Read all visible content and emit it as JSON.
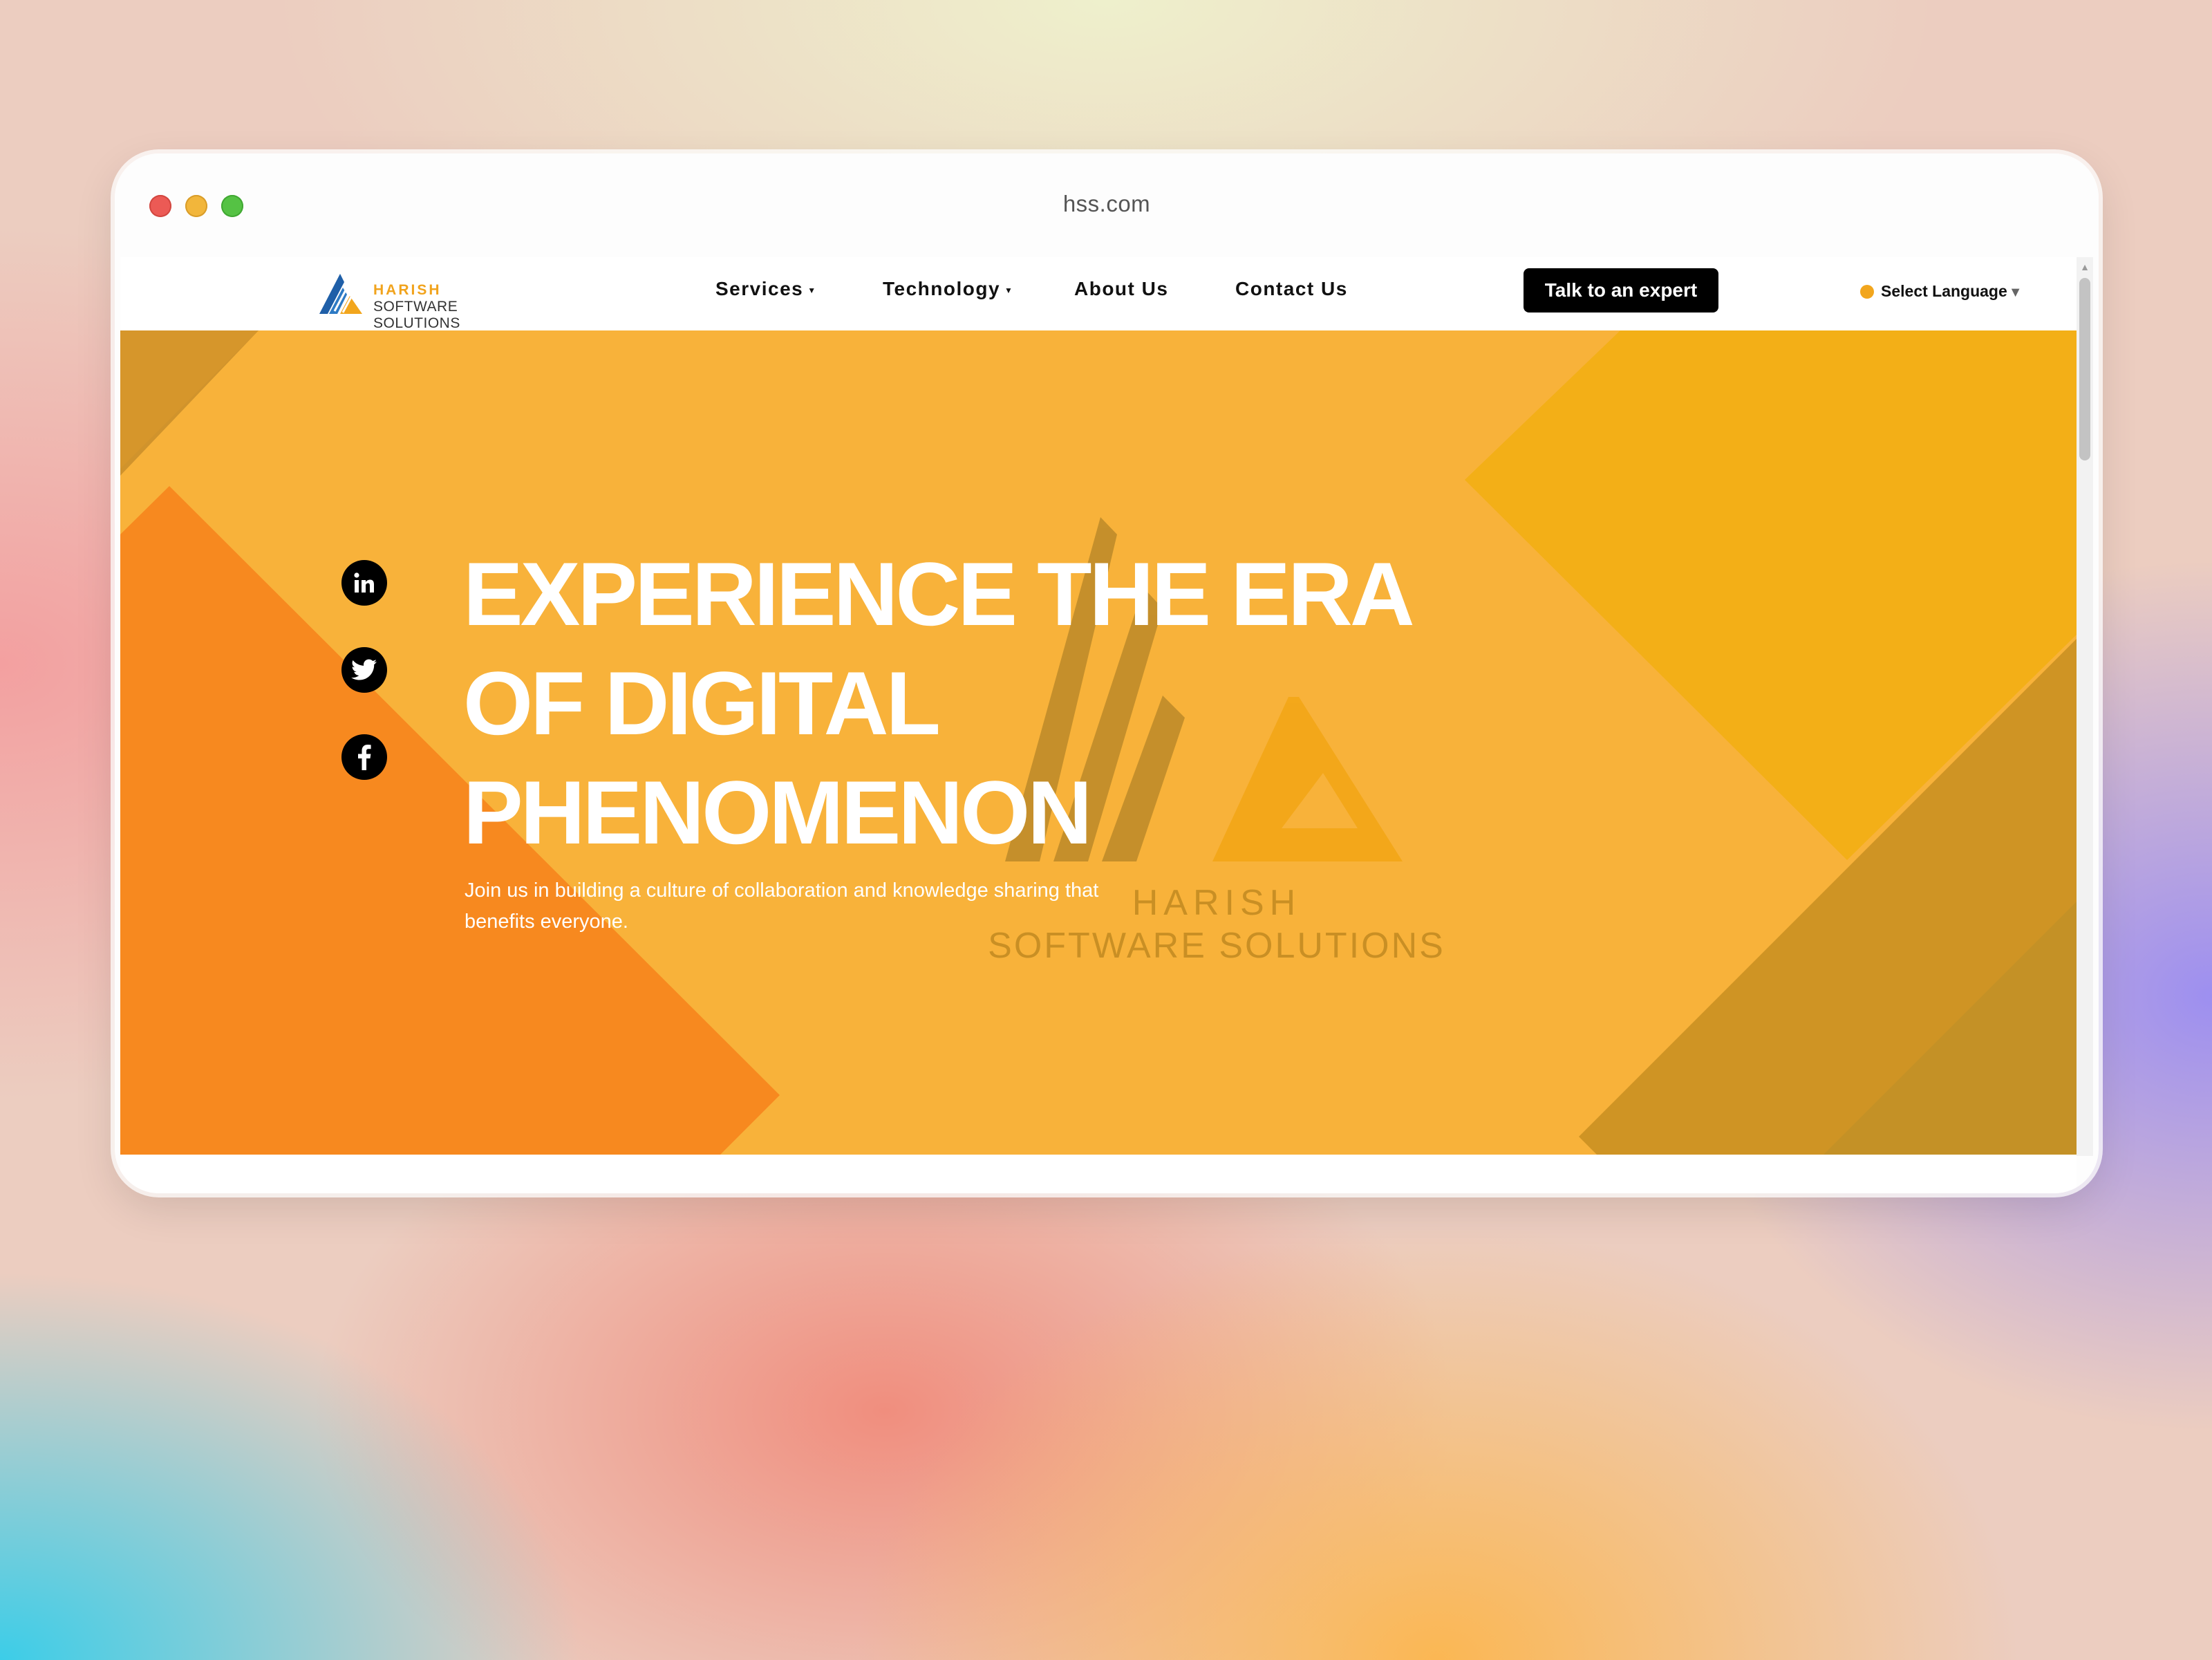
{
  "browser": {
    "url": "hss.com"
  },
  "header": {
    "logo": {
      "brand_top": "HARISH",
      "brand_bottom": "SOFTWARE SOLUTIONS"
    },
    "nav": [
      {
        "label": "Services",
        "has_dropdown": true
      },
      {
        "label": "Technology",
        "has_dropdown": true
      },
      {
        "label": "About Us",
        "has_dropdown": false
      },
      {
        "label": "Contact Us",
        "has_dropdown": false
      }
    ],
    "cta_label": "Talk to an expert",
    "language_label": "Select Language",
    "language_arrow": "▼"
  },
  "hero": {
    "headline_lines": [
      "EXPERIENCE THE ERA",
      "OF DIGITAL",
      "PHENOMENON"
    ],
    "subtext": "Join us in building a culture of collaboration and knowledge sharing that benefits everyone.",
    "watermark_top": "HARISH",
    "watermark_bottom": "SOFTWARE SOLUTIONS",
    "social_icons": [
      "linkedin-icon",
      "twitter-icon",
      "facebook-icon"
    ]
  },
  "colors": {
    "hero_background": "#f8b23a",
    "left_shape": "#f7891f",
    "accent": "#f2a61d",
    "cta_background": "#000000"
  }
}
